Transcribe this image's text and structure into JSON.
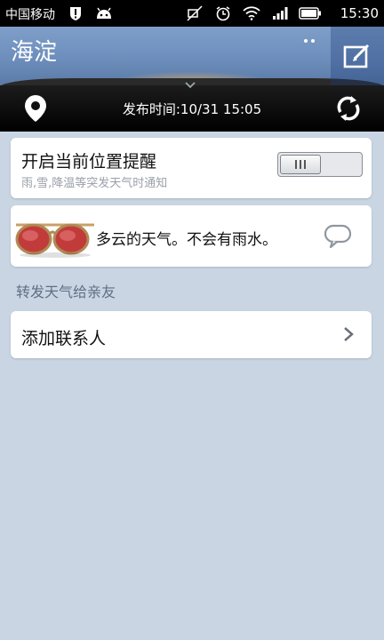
{
  "statusbar": {
    "carrier": "中国移动",
    "time": "15:30",
    "icons": [
      "notification-alert-icon",
      "android-icon",
      "mute-icon",
      "alarm-icon",
      "wifi-icon",
      "signal-icon",
      "battery-icon"
    ]
  },
  "header": {
    "city": "海淀",
    "publish_time": "发布时间:10/31 15:05"
  },
  "location_alert": {
    "title": "开启当前位置提醒",
    "subtitle": "雨,雪,降温等突发天气时通知",
    "toggle_on": false
  },
  "weather_tip": {
    "text": "多云的天气。不会有雨水。"
  },
  "share": {
    "section_label": "转发天气给亲友",
    "add_contact": "添加联系人"
  },
  "colors": {
    "background": "#c9d5e3",
    "header": "#6d8ebc",
    "infobar": "#000000",
    "card": "#ffffff"
  }
}
